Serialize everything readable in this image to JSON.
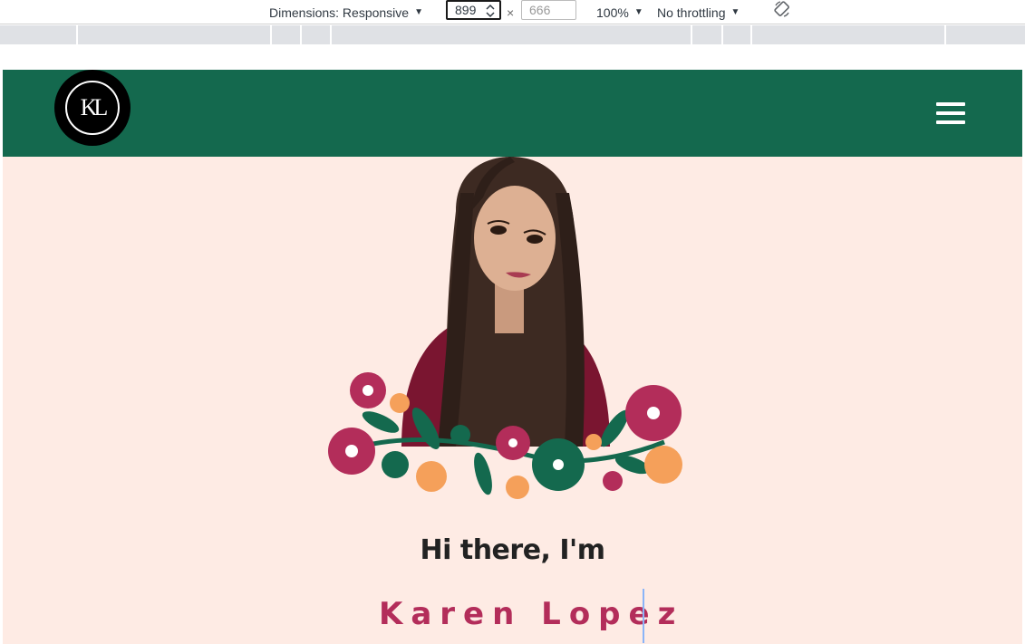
{
  "devtools": {
    "dimensions_label": "Dimensions: Responsive",
    "width_value": "899",
    "height_placeholder": "666",
    "times_symbol": "×",
    "zoom": "100%",
    "throttling": "No throttling",
    "caret": "▼"
  },
  "site": {
    "logo_text": "KL",
    "greeting": "Hi there, I'm",
    "name": "Karen Lopez"
  },
  "colors": {
    "nav_green": "#14694e",
    "page_bg": "#feebe4",
    "name_color": "#b32d5a",
    "flower_pink": "#b32d5a",
    "flower_orange": "#f5a05a",
    "flower_green": "#14694e"
  },
  "icons": {
    "rotate": "rotate-icon",
    "menu": "hamburger-menu-icon",
    "spinner": "spinner-arrows-icon"
  }
}
